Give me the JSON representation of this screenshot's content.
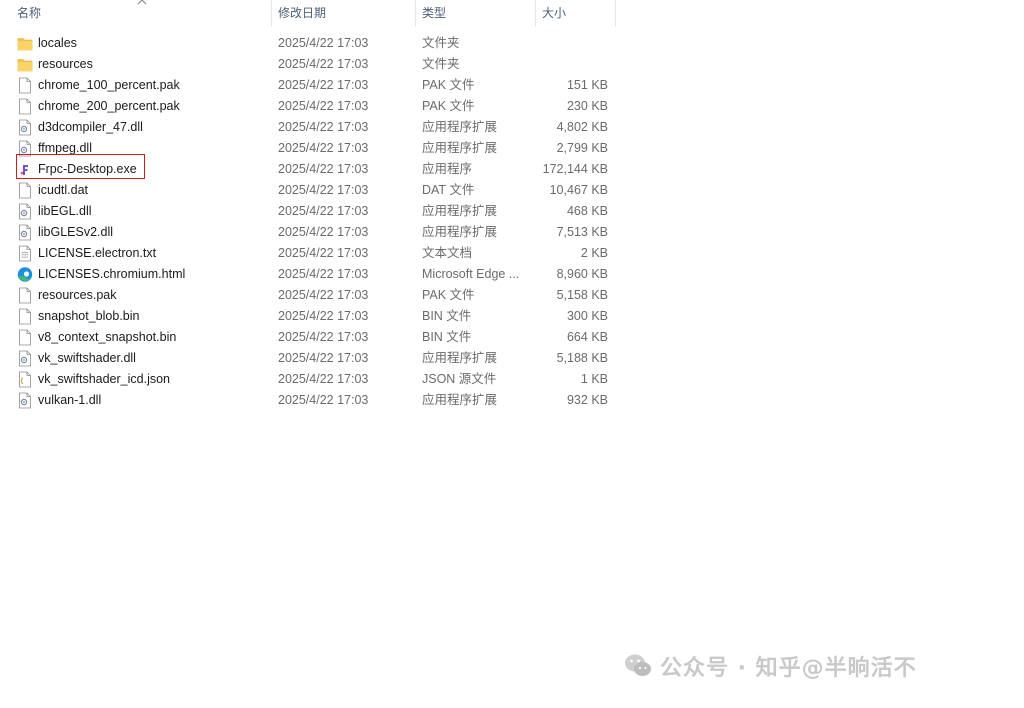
{
  "columns": {
    "name": "名称",
    "date": "修改日期",
    "type": "类型",
    "size": "大小"
  },
  "files": [
    {
      "name": "locales",
      "date": "2025/4/22 17:03",
      "type": "文件夹",
      "size": "",
      "icon": "folder-icon"
    },
    {
      "name": "resources",
      "date": "2025/4/22 17:03",
      "type": "文件夹",
      "size": "",
      "icon": "folder-icon"
    },
    {
      "name": "chrome_100_percent.pak",
      "date": "2025/4/22 17:03",
      "type": "PAK 文件",
      "size": "151 KB",
      "icon": "file-icon"
    },
    {
      "name": "chrome_200_percent.pak",
      "date": "2025/4/22 17:03",
      "type": "PAK 文件",
      "size": "230 KB",
      "icon": "file-icon"
    },
    {
      "name": "d3dcompiler_47.dll",
      "date": "2025/4/22 17:03",
      "type": "应用程序扩展",
      "size": "4,802 KB",
      "icon": "dll-icon"
    },
    {
      "name": "ffmpeg.dll",
      "date": "2025/4/22 17:03",
      "type": "应用程序扩展",
      "size": "2,799 KB",
      "icon": "dll-icon"
    },
    {
      "name": "Frpc-Desktop.exe",
      "date": "2025/4/22 17:03",
      "type": "应用程序",
      "size": "172,144 KB",
      "icon": "app-icon",
      "highlighted": true
    },
    {
      "name": "icudtl.dat",
      "date": "2025/4/22 17:03",
      "type": "DAT 文件",
      "size": "10,467 KB",
      "icon": "file-icon"
    },
    {
      "name": "libEGL.dll",
      "date": "2025/4/22 17:03",
      "type": "应用程序扩展",
      "size": "468 KB",
      "icon": "dll-icon"
    },
    {
      "name": "libGLESv2.dll",
      "date": "2025/4/22 17:03",
      "type": "应用程序扩展",
      "size": "7,513 KB",
      "icon": "dll-icon"
    },
    {
      "name": "LICENSE.electron.txt",
      "date": "2025/4/22 17:03",
      "type": "文本文档",
      "size": "2 KB",
      "icon": "text-file-icon"
    },
    {
      "name": "LICENSES.chromium.html",
      "date": "2025/4/22 17:03",
      "type": "Microsoft Edge ...",
      "size": "8,960 KB",
      "icon": "edge-icon"
    },
    {
      "name": "resources.pak",
      "date": "2025/4/22 17:03",
      "type": "PAK 文件",
      "size": "5,158 KB",
      "icon": "file-icon"
    },
    {
      "name": "snapshot_blob.bin",
      "date": "2025/4/22 17:03",
      "type": "BIN 文件",
      "size": "300 KB",
      "icon": "file-icon"
    },
    {
      "name": "v8_context_snapshot.bin",
      "date": "2025/4/22 17:03",
      "type": "BIN 文件",
      "size": "664 KB",
      "icon": "file-icon"
    },
    {
      "name": "vk_swiftshader.dll",
      "date": "2025/4/22 17:03",
      "type": "应用程序扩展",
      "size": "5,188 KB",
      "icon": "dll-icon"
    },
    {
      "name": "vk_swiftshader_icd.json",
      "date": "2025/4/22 17:03",
      "type": "JSON 源文件",
      "size": "1 KB",
      "icon": "json-icon"
    },
    {
      "name": "vulkan-1.dll",
      "date": "2025/4/22 17:03",
      "type": "应用程序扩展",
      "size": "932 KB",
      "icon": "dll-icon"
    }
  ],
  "watermark": {
    "text": "公众号 · 知乎@半晌活不"
  },
  "colors": {
    "folder": "#f6c34a",
    "highlight_border": "#d01c1c",
    "edge_blue": "#1d8fe1",
    "edge_green": "#3bc16a"
  }
}
